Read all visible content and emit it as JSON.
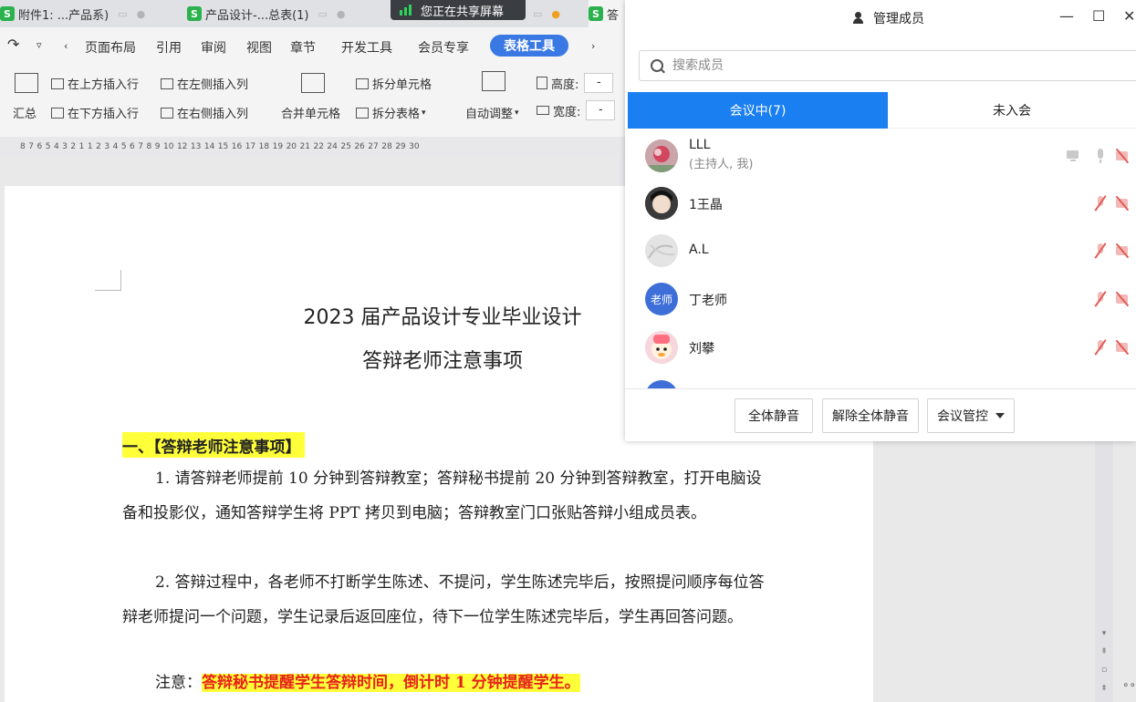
{
  "tabs": [
    {
      "label": "附件1: ...产品系)"
    },
    {
      "label": "产品设计-...总表(1)"
    },
    {
      "label": "答"
    }
  ],
  "share_banner": {
    "label": "您正在共享屏幕"
  },
  "menu": {
    "items": [
      "页面布局",
      "引用",
      "审阅",
      "视图",
      "章节",
      "开发工具",
      "会员专享"
    ],
    "active": "表格工具"
  },
  "ribbon": {
    "summary": "汇总",
    "insert_above": "在上方插入行",
    "insert_below": "在下方插入行",
    "insert_left": "在左侧插入列",
    "insert_right": "在右侧插入列",
    "merge_cells": "合并单元格",
    "split_cells": "拆分单元格",
    "split_table": "拆分表格",
    "auto_adjust": "自动调整",
    "height_label": "高度:",
    "width_label": "宽度:",
    "height_value": "-",
    "width_value": "-"
  },
  "ruler": {
    "marks": [
      "8",
      "7",
      "6",
      "5",
      "4",
      "3",
      "2",
      "1",
      "1",
      "2",
      "3",
      "4",
      "5",
      "6",
      "7",
      "8",
      "9",
      "10",
      "12",
      "13",
      "14",
      "15",
      "16",
      "17",
      "18",
      "19",
      "20",
      "21",
      "22",
      "24",
      "25",
      "26",
      "27",
      "28",
      "29",
      "30"
    ]
  },
  "document": {
    "title_line1": "2023 届产品设计专业毕业设计",
    "title_line2": "答辩老师注意事项",
    "section_heading": "一、【答辩老师注意事项】",
    "para1": "1. 请答辩老师提前 10 分钟到答辩教室；答辩秘书提前 20 分钟到答辩教室，打开电脑设备和投影仪，通知答辩学生将 PPT 拷贝到电脑；答辩教室门口张贴答辩小组成员表。",
    "para2": "2. 答辩过程中，各老师不打断学生陈述、不提问，学生陈述完毕后，按照提问顺序每位答辩老师提问一个问题，学生记录后返回座位，待下一位学生陈述完毕后，学生再回答问题。",
    "note_label": "注意：",
    "note_text": "答辩秘书提醒学生答辩时间，倒计时 1 分钟提醒学生。"
  },
  "panel": {
    "title": "管理成员",
    "search_placeholder": "搜索成员",
    "tab_in_meeting": "会议中(7)",
    "tab_not_joined": "未入会",
    "members": [
      {
        "name": "LLL",
        "role": "(主持人, 我)"
      },
      {
        "name": "1王晶"
      },
      {
        "name": "A.L"
      },
      {
        "name": "丁老师",
        "avatar_text": "老师"
      },
      {
        "name": "刘攀"
      }
    ],
    "btn_mute_all": "全体静音",
    "btn_unmute_all": "解除全体静音",
    "btn_meeting_control": "会议管控"
  },
  "colors": {
    "accent": "#1a7ff0",
    "ribbon_active": "#3a79e4",
    "highlight": "#ffff3a",
    "note_red": "#e6231b"
  }
}
